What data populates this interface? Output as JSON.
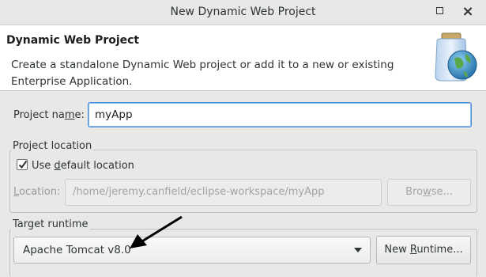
{
  "window": {
    "title": "New Dynamic Web Project"
  },
  "banner": {
    "title": "Dynamic Web Project",
    "description": "Create a standalone Dynamic Web project or add it to a new or existing Enterprise Application.",
    "icon": "web-project-wizard-icon"
  },
  "project_name": {
    "label_pre": "Project na",
    "label_mnemonic": "m",
    "label_post": "e:",
    "value": "myApp"
  },
  "project_location": {
    "caption": "Project location",
    "use_default": {
      "label_pre": "Use ",
      "label_mnemonic": "d",
      "label_post": "efault location",
      "checked": true
    },
    "location_label_mnemonic": "L",
    "location_label_post": "ocation:",
    "location_value": "/home/jeremy.canfield/eclipse-workspace/myApp",
    "browse_pre": "Bro",
    "browse_mnemonic": "w",
    "browse_post": "se..."
  },
  "target_runtime": {
    "caption": "Target runtime",
    "selected": "Apache Tomcat v8.0",
    "new_runtime_pre": "New ",
    "new_runtime_mnemonic": "R",
    "new_runtime_post": "untime..."
  },
  "colors": {
    "accent": "#4a90d9",
    "window_bg": "#e8e8e7"
  }
}
